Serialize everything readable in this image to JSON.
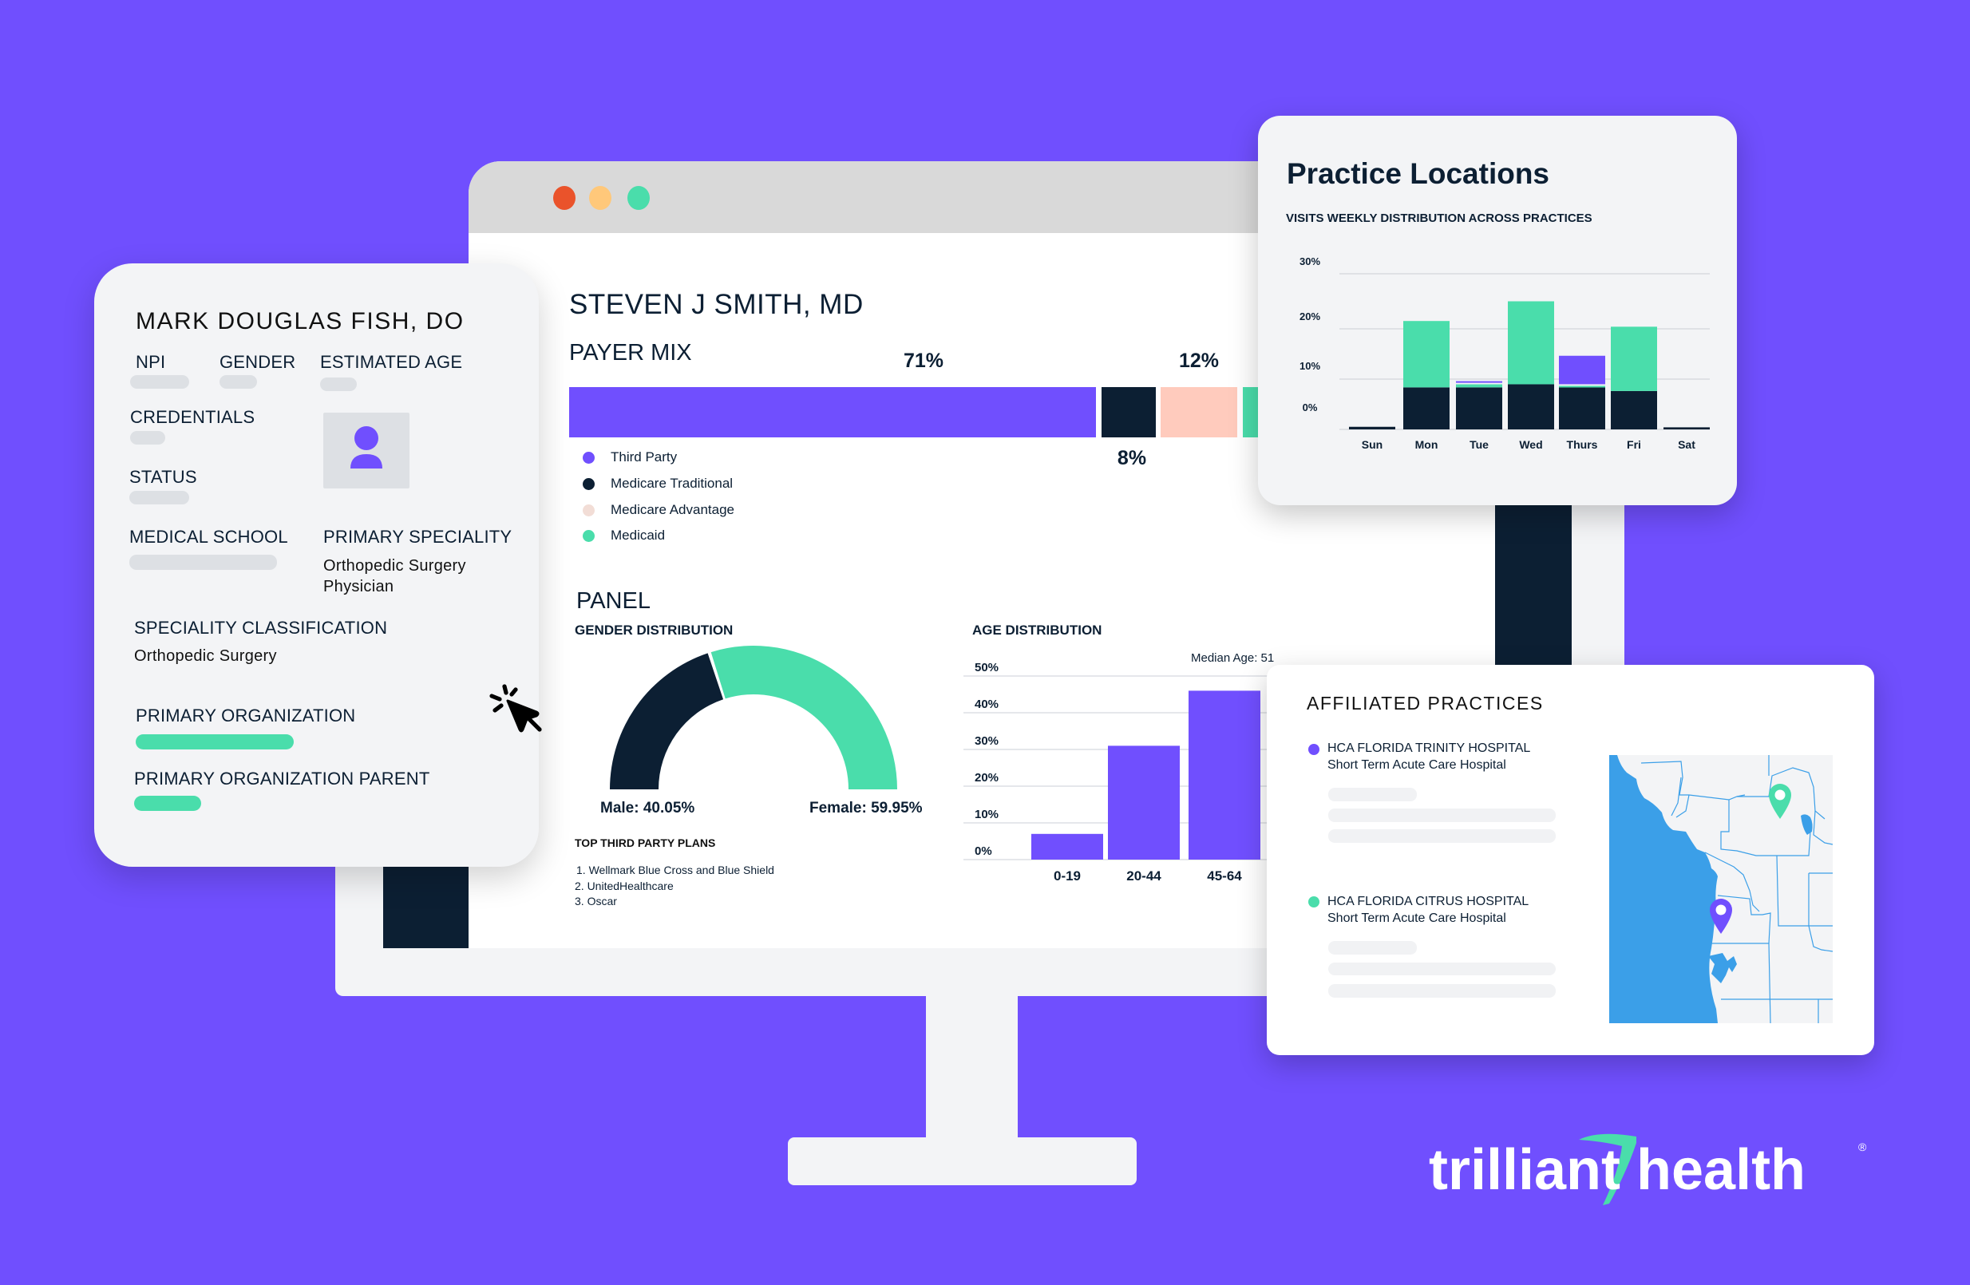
{
  "colors": {
    "background": "#704ffe",
    "purple": "#704ffe",
    "navy": "#0c1f33",
    "green": "#4addab",
    "peach": "#ffcbbd",
    "advantage_dot": "#f2ddd6",
    "map_water": "#3b9fe8",
    "map_land": "#f3f4f6",
    "traffic_red": "#ea532b",
    "traffic_yellow": "#ffc87a",
    "traffic_green": "#4addab"
  },
  "browser": {
    "traffic_lights": [
      "close",
      "minimize",
      "maximize"
    ]
  },
  "provider_card": {
    "name": "MARK DOUGLAS FISH, DO",
    "fields": {
      "npi": "NPI",
      "gender": "GENDER",
      "estimated_age": "ESTIMATED AGE",
      "credentials": "CREDENTIALS",
      "status": "STATUS",
      "medical_school": "MEDICAL SCHOOL",
      "primary_speciality": "PRIMARY SPECIALITY",
      "primary_speciality_value_line1": "Orthopedic Surgery",
      "primary_speciality_value_line2": "Physician",
      "speciality_classification": "SPECIALITY CLASSIFICATION",
      "speciality_classification_value": "Orthopedic Surgery",
      "primary_organization": "PRIMARY ORGANIZATION",
      "primary_organization_parent": "PRIMARY ORGANIZATION PARENT"
    },
    "avatar_icon": "person-icon",
    "cursor_icon": "click-cursor-icon"
  },
  "dashboard": {
    "provider_name": "STEVEN J SMITH, MD",
    "payer_mix": {
      "title": "PAYER MIX",
      "labels": {
        "third_party": "71%",
        "medicare_traditional": "8%",
        "medicare_advantage": "12%"
      },
      "legend": [
        "Third Party",
        "Medicare Traditional",
        "Medicare Advantage",
        "Medicaid"
      ]
    },
    "panel": {
      "title": "PANEL",
      "gender_title": "GENDER DISTRIBUTION",
      "male_label": "Male: 40.05%",
      "female_label": "Female: 59.95%",
      "plans_title": "TOP THIRD PARTY PLANS",
      "plans": [
        "1. Wellmark Blue Cross and Blue Shield",
        "2. UnitedHealthcare",
        "3. Oscar"
      ],
      "age_title": "AGE DISTRIBUTION",
      "median_age": "Median Age: 51"
    }
  },
  "practice_locations": {
    "title": "Practice Locations",
    "subtitle": "VISITS WEEKLY DISTRIBUTION ACROSS PRACTICES"
  },
  "affiliated_practices": {
    "title": "AFFILIATED PRACTICES",
    "items": [
      {
        "name": "HCA FLORIDA TRINITY HOSPITAL",
        "type": "Short Term Acute Care Hospital",
        "color": "#704ffe"
      },
      {
        "name": "HCA FLORIDA CITRUS HOSPITAL",
        "type": "Short Term Acute Care Hospital",
        "color": "#4addab"
      }
    ],
    "map_pins": [
      "map-pin-green",
      "map-pin-purple"
    ]
  },
  "brand": {
    "logo_left": "trilliant",
    "logo_right": "health",
    "registered": "®"
  },
  "chart_data": [
    {
      "type": "bar",
      "title": "PAYER MIX",
      "orientation": "horizontal-stacked",
      "categories": [
        "Third Party",
        "Medicare Traditional",
        "Medicare Advantage",
        "Medicaid"
      ],
      "values": [
        71,
        8,
        12,
        9
      ],
      "value_labels": [
        "71%",
        "8%",
        "12%",
        null
      ],
      "colors": [
        "#704ffe",
        "#0c1f33",
        "#ffcbbd",
        "#4addab"
      ],
      "legend": "bottom-left"
    },
    {
      "type": "pie",
      "title": "GENDER DISTRIBUTION",
      "style": "half-donut",
      "categories": [
        "Male",
        "Female"
      ],
      "values": [
        40.05,
        59.95
      ],
      "colors": [
        "#0c1f33",
        "#4addab"
      ]
    },
    {
      "type": "bar",
      "title": "AGE DISTRIBUTION",
      "categories": [
        "0-19",
        "20-44",
        "45-64"
      ],
      "values": [
        7,
        31,
        46
      ],
      "yticks": [
        "0%",
        "10%",
        "20%",
        "30%",
        "40%",
        "50%"
      ],
      "ylim": [
        0,
        50
      ],
      "annotation": "Median Age: 51",
      "grid": true,
      "color": "#704ffe"
    },
    {
      "type": "bar",
      "title": "VISITS WEEKLY DISTRIBUTION ACROSS PRACTICES",
      "stacked": true,
      "categories": [
        "Sun",
        "Mon",
        "Tue",
        "Wed",
        "Thurs",
        "Fri",
        "Sat"
      ],
      "series": [
        {
          "name": "navy",
          "color": "#0c1f33",
          "values": [
            0.5,
            8.1,
            8.1,
            8.7,
            8.1,
            7.4,
            0.4
          ]
        },
        {
          "name": "green",
          "color": "#4addab",
          "values": [
            0,
            13.1,
            0.9,
            16.3,
            0.6,
            12.7,
            0
          ]
        },
        {
          "name": "purple",
          "color": "#704ffe",
          "values": [
            0,
            0,
            0.6,
            0,
            5.8,
            0,
            0
          ]
        }
      ],
      "yticks": [
        "0%",
        "10%",
        "20%",
        "30%"
      ],
      "ylim": [
        0,
        30
      ],
      "grid": true
    }
  ]
}
